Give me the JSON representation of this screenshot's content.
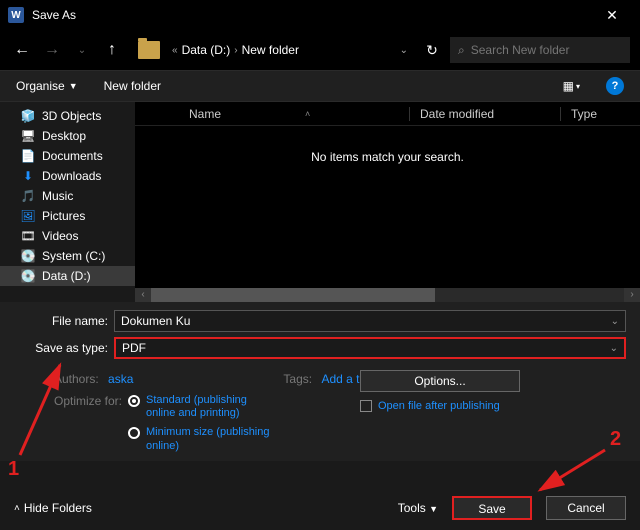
{
  "window": {
    "title": "Save As"
  },
  "nav": {
    "path": [
      "Data (D:)",
      "New folder"
    ],
    "search_placeholder": "Search New folder"
  },
  "toolbar": {
    "organise": "Organise",
    "new_folder": "New folder"
  },
  "tree": {
    "items": [
      {
        "icon": "🧊",
        "label": "3D Objects"
      },
      {
        "icon": "🖥",
        "label": "Desktop"
      },
      {
        "icon": "📄",
        "label": "Documents"
      },
      {
        "icon": "⬇",
        "label": "Downloads",
        "blue": true
      },
      {
        "icon": "🎵",
        "label": "Music",
        "blue": true
      },
      {
        "icon": "🖼",
        "label": "Pictures",
        "blue": true
      },
      {
        "icon": "🎞",
        "label": "Videos"
      },
      {
        "icon": "💽",
        "label": "System (C:)"
      },
      {
        "icon": "💽",
        "label": "Data (D:)",
        "selected": true
      }
    ]
  },
  "cols": {
    "name": "Name",
    "date": "Date modified",
    "type": "Type"
  },
  "empty": "No items match your search.",
  "fields": {
    "filename_label": "File name:",
    "filename_value": "Dokumen Ku",
    "filetype_label": "Save as type:",
    "filetype_value": "PDF"
  },
  "meta": {
    "authors_label": "Authors:",
    "authors_value": "aska",
    "tags_label": "Tags:",
    "tags_value": "Add a tag"
  },
  "optimize": {
    "label": "Optimize for:",
    "opt_standard": "Standard (publishing online and printing)",
    "opt_minimum": "Minimum size (publishing online)"
  },
  "options": {
    "options_btn": "Options...",
    "open_after": "Open file after publishing"
  },
  "footer": {
    "hide_folders": "Hide Folders",
    "tools": "Tools",
    "save": "Save",
    "cancel": "Cancel"
  },
  "annotations": {
    "num1": "1",
    "num2": "2"
  }
}
